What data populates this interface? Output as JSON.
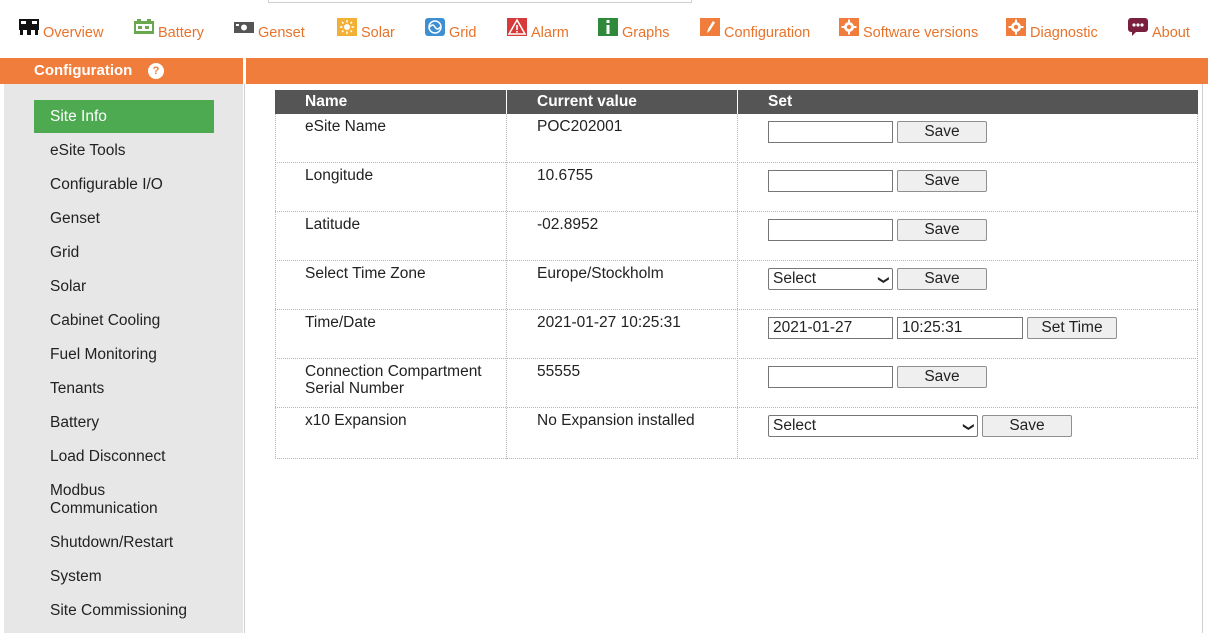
{
  "nav": [
    {
      "label": "Overview",
      "icon": "overview-icon"
    },
    {
      "label": "Battery",
      "icon": "battery-icon"
    },
    {
      "label": "Genset",
      "icon": "genset-icon"
    },
    {
      "label": "Solar",
      "icon": "solar-icon"
    },
    {
      "label": "Grid",
      "icon": "grid-icon"
    },
    {
      "label": "Alarm",
      "icon": "alarm-icon"
    },
    {
      "label": "Graphs",
      "icon": "info-icon"
    },
    {
      "label": "Configuration",
      "icon": "pencil-icon"
    },
    {
      "label": "Software versions",
      "icon": "gear-icon"
    },
    {
      "label": "Diagnostic",
      "icon": "gear-icon"
    },
    {
      "label": "About",
      "icon": "chat-icon"
    }
  ],
  "section": {
    "title": "Configuration",
    "help": "?"
  },
  "sidebar": {
    "items": [
      {
        "label": "Site Info",
        "active": true
      },
      {
        "label": "eSite Tools"
      },
      {
        "label": "Configurable I/O"
      },
      {
        "label": "Genset"
      },
      {
        "label": "Grid"
      },
      {
        "label": "Solar"
      },
      {
        "label": "Cabinet Cooling"
      },
      {
        "label": "Fuel Monitoring"
      },
      {
        "label": "Tenants"
      },
      {
        "label": "Battery"
      },
      {
        "label": "Load Disconnect"
      },
      {
        "label": "Modbus Communication"
      },
      {
        "label": "Shutdown/Restart"
      },
      {
        "label": "System"
      },
      {
        "label": "Site Commissioning"
      }
    ]
  },
  "table": {
    "headers": {
      "name": "Name",
      "value": "Current value",
      "set": "Set"
    },
    "rows": [
      {
        "name": "eSite Name",
        "value": "POC202001",
        "input": "",
        "button": "Save"
      },
      {
        "name": "Longitude",
        "value": "10.6755",
        "input": "",
        "button": "Save"
      },
      {
        "name": "Latitude",
        "value": "-02.8952",
        "input": "",
        "button": "Save"
      },
      {
        "name": "Select Time Zone",
        "value": "Europe/Stockholm",
        "select": "Select",
        "button": "Save"
      },
      {
        "name": "Time/Date",
        "value": "2021-01-27 10:25:31",
        "date": "2021-01-27",
        "time": "10:25:31",
        "button": "Set Time"
      },
      {
        "name": "Connection Compartment Serial Number",
        "value": "55555",
        "input": "",
        "button": "Save"
      },
      {
        "name": "x10 Expansion",
        "value": "No Expansion installed",
        "select": "Select",
        "button": "Save"
      }
    ]
  },
  "colors": {
    "accent": "#f07d3b",
    "active": "#4daa51",
    "header": "#555555",
    "link": "#e8732a"
  }
}
